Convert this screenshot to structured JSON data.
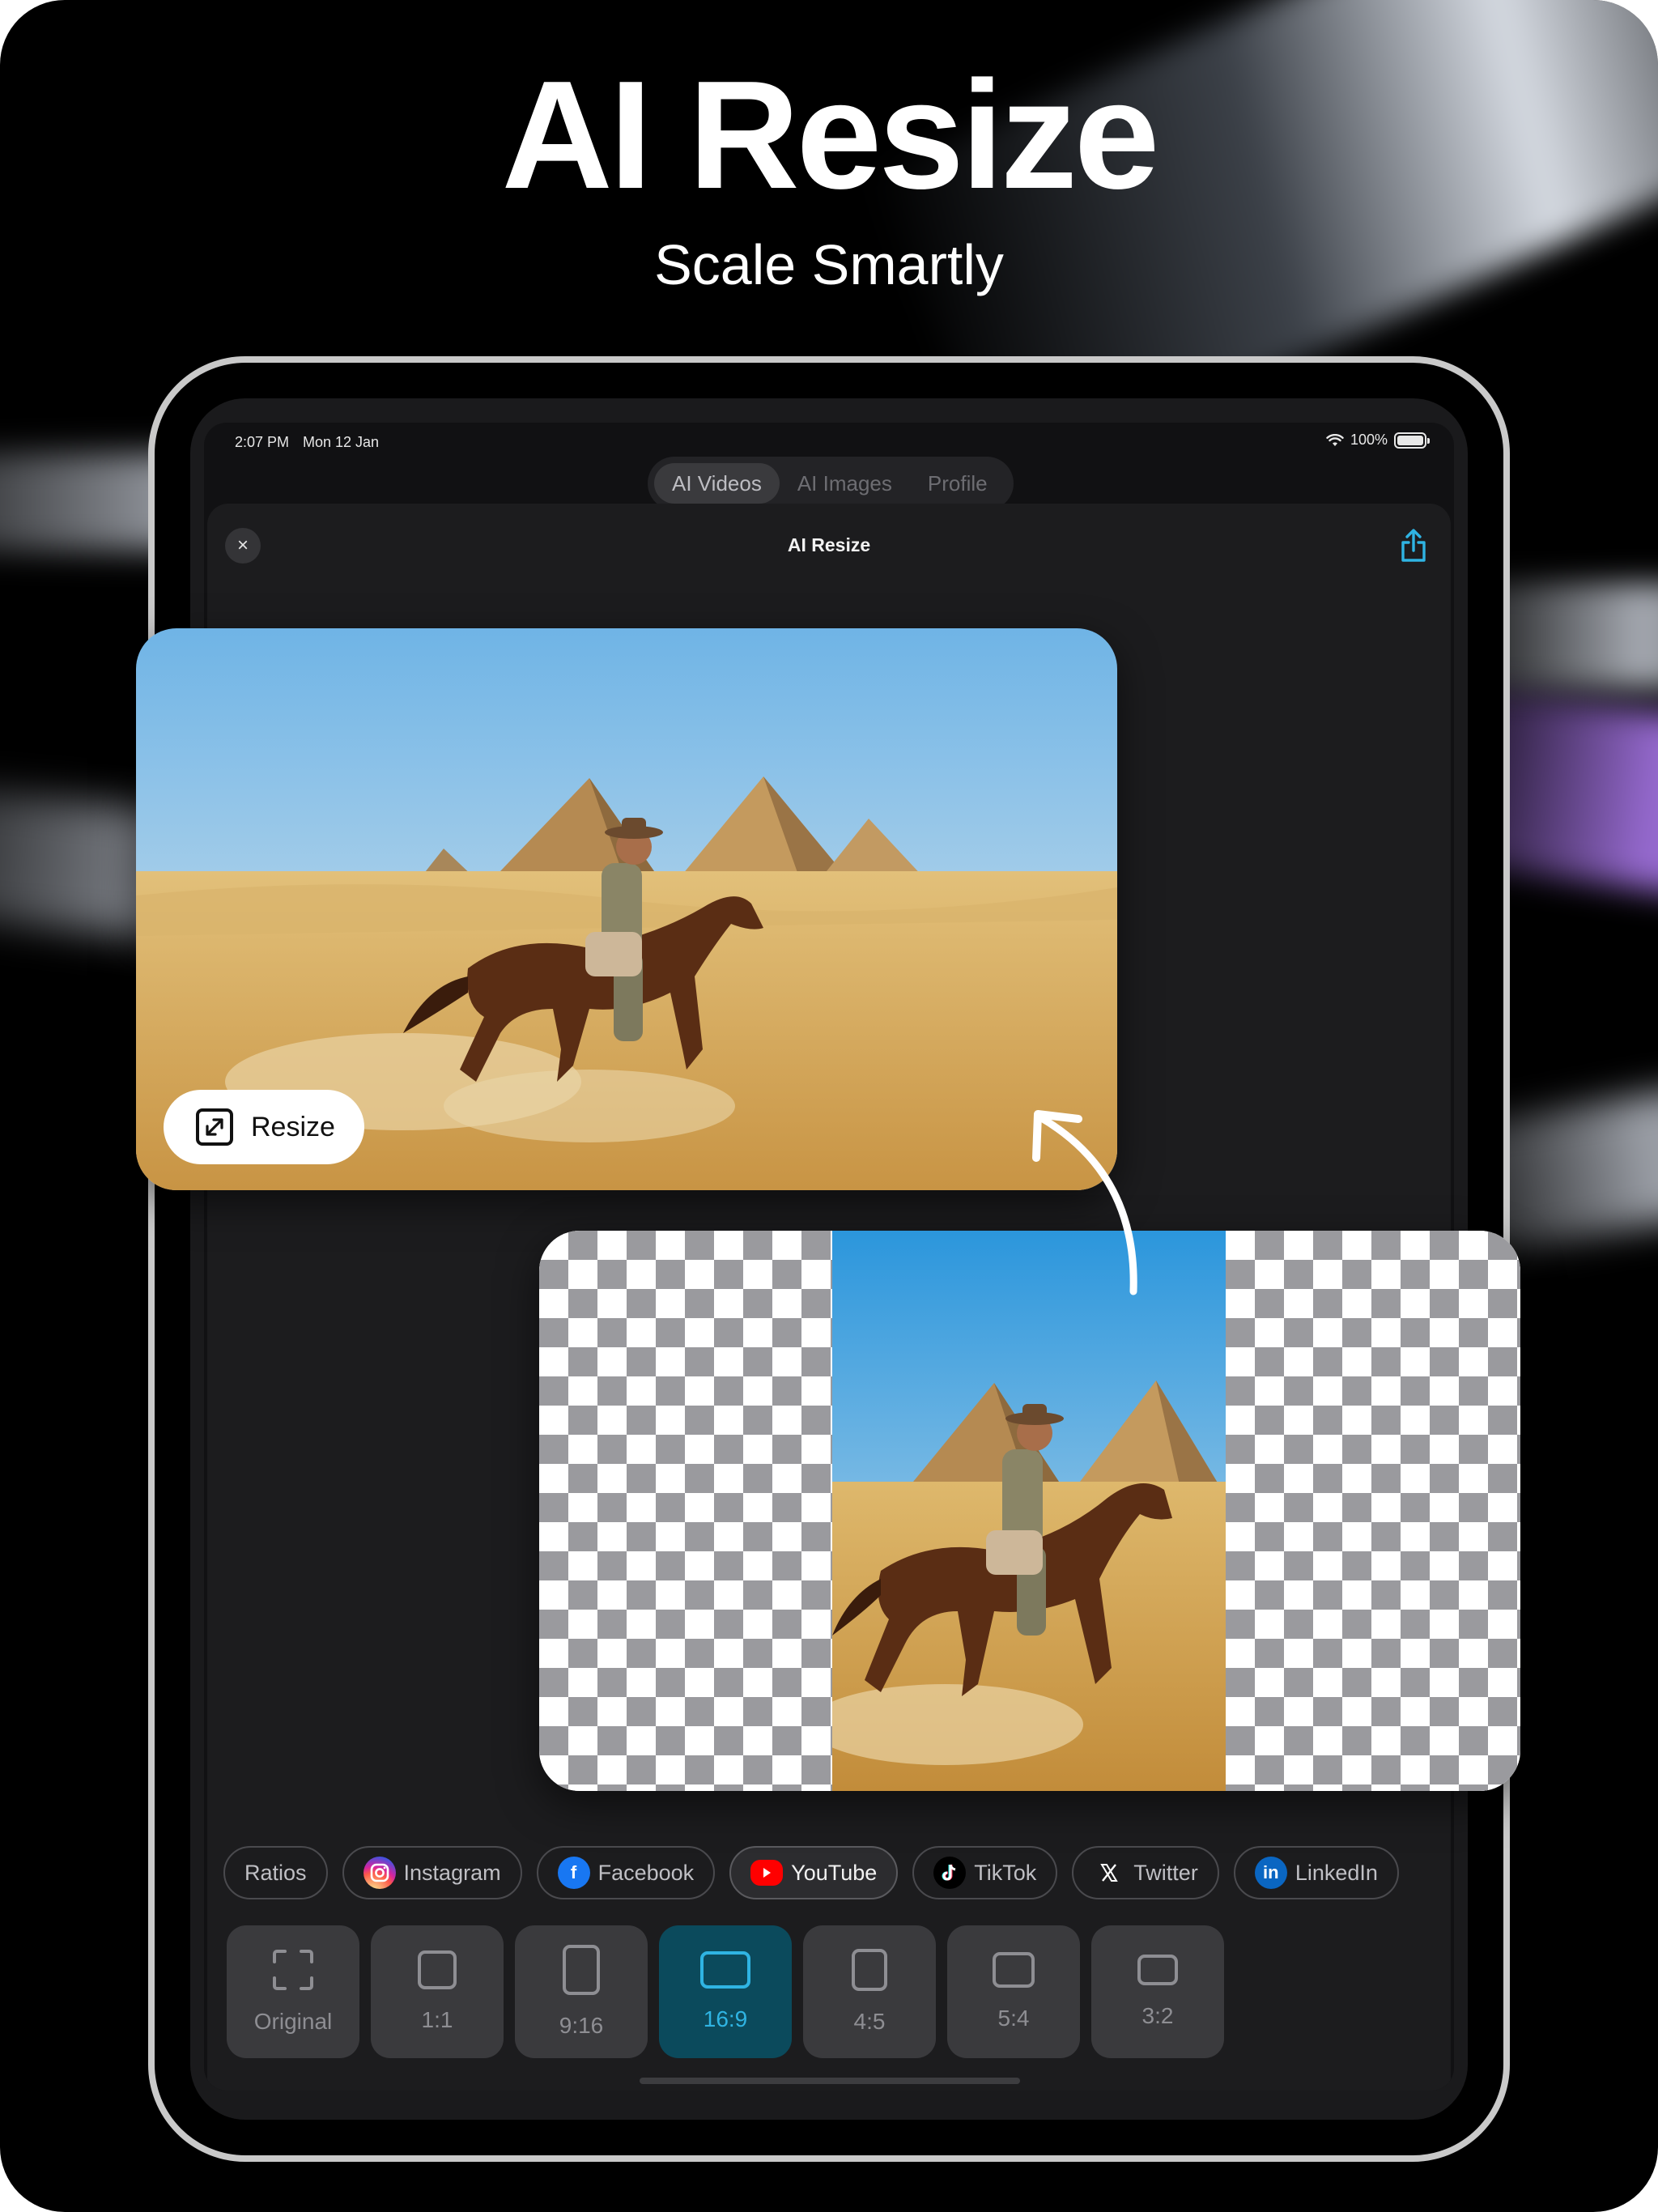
{
  "hero": {
    "title": "AI Resize",
    "subtitle": "Scale Smartly"
  },
  "status_bar": {
    "time": "2:07 PM",
    "date": "Mon 12 Jan",
    "battery": "100%"
  },
  "tabs": [
    {
      "label": "AI Videos",
      "active": true
    },
    {
      "label": "AI Images",
      "active": false
    },
    {
      "label": "Profile",
      "active": false
    }
  ],
  "sheet": {
    "title": "AI Resize",
    "close_symbol": "×"
  },
  "resize_button": {
    "label": "Resize",
    "icon": "expand-arrows-icon"
  },
  "platform_chips": [
    {
      "label": "Ratios",
      "icon": "",
      "active": false
    },
    {
      "label": "Instagram",
      "icon": "instagram-icon",
      "active": false
    },
    {
      "label": "Facebook",
      "icon": "facebook-icon",
      "active": false
    },
    {
      "label": "YouTube",
      "icon": "youtube-icon",
      "active": true
    },
    {
      "label": "TikTok",
      "icon": "tiktok-icon",
      "active": false
    },
    {
      "label": "Twitter",
      "icon": "x-icon",
      "active": false
    },
    {
      "label": "LinkedIn",
      "icon": "linkedin-icon",
      "active": false
    }
  ],
  "ratio_options": [
    {
      "label": "Original",
      "active": false
    },
    {
      "label": "1:1",
      "active": false
    },
    {
      "label": "9:16",
      "active": false
    },
    {
      "label": "16:9",
      "active": true
    },
    {
      "label": "4:5",
      "active": false
    },
    {
      "label": "5:4",
      "active": false
    },
    {
      "label": "3:2",
      "active": false
    }
  ],
  "colors": {
    "accent": "#2fb4e3",
    "accent_bg": "#0b4a5c",
    "sheet_bg": "#1c1c1e",
    "instagram": "#e1306c",
    "facebook": "#1877f2",
    "youtube": "#ff0000",
    "linkedin": "#0a66c2"
  }
}
